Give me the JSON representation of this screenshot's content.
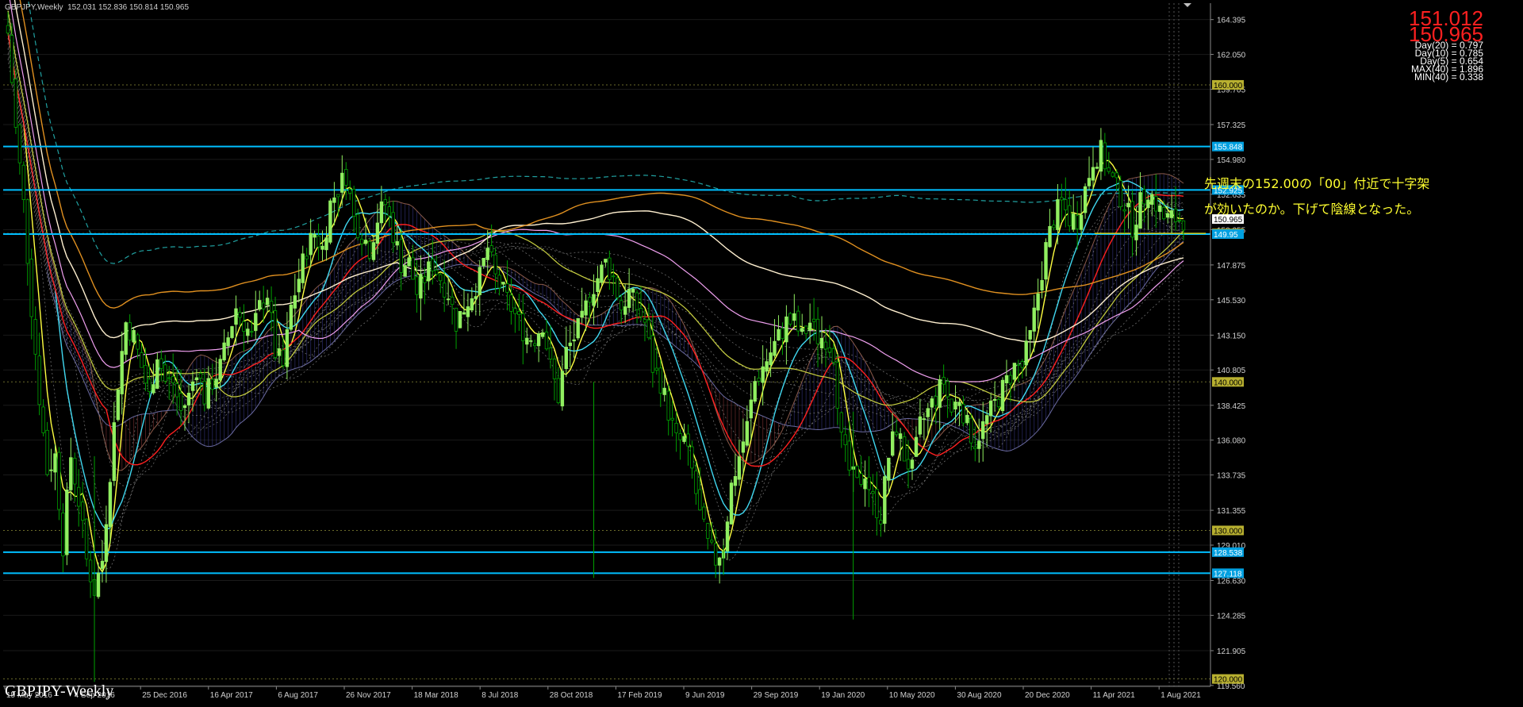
{
  "header": {
    "symbol_text": "GBPJPY,Weekly",
    "ohlc_text": "152.031 152.836 150.814 150.965"
  },
  "price_panel": {
    "bid": "151.012",
    "ask": "150.965",
    "stats": [
      "Day(20) = 0.797",
      "Day(10) = 0.785",
      "Day(5) = 0.654",
      "MAX(40) = 1.896",
      "MIN(40) = 0.338"
    ]
  },
  "caption": "GBPJPY-Weekly",
  "annotation": {
    "line1": "先週末の152.00の「00」付近で十字架",
    "line2": "が効いたのか。下げて陰線となった。"
  },
  "colors": {
    "background": "#000000",
    "bull_candle": "#90ee60",
    "bear_candle": "#00a000",
    "hline": "#00bfff",
    "bid": "#ff2020",
    "ask": "#ff2020",
    "annotation": "#ffff30"
  },
  "chart_data": {
    "type": "candlestick",
    "y_axis": {
      "range": [
        119.5,
        165.5
      ],
      "ticks": [
        "164.395",
        "162.050",
        "159.705",
        "157.325",
        "154.980",
        "152.635",
        "150.255",
        "147.875",
        "145.530",
        "143.150",
        "140.805",
        "138.425",
        "136.080",
        "133.735",
        "131.355",
        "129.010",
        "126.630",
        "124.285",
        "121.905",
        "119.560"
      ]
    },
    "x_axis": {
      "labels": [
        "15 May 2016",
        "4 Sep 2016",
        "25 Dec 2016",
        "16 Apr 2017",
        "6 Aug 2017",
        "26 Nov 2017",
        "18 Mar 2018",
        "8 Jul 2018",
        "28 Oct 2018",
        "17 Feb 2019",
        "9 Jun 2019",
        "29 Sep 2019",
        "19 Jan 2020",
        "10 May 2020",
        "30 Aug 2020",
        "20 Dec 2020",
        "11 Apr 2021",
        "1 Aug 2021"
      ]
    },
    "horizontal_lines": [
      {
        "value": 155.848,
        "label": "155.848"
      },
      {
        "value": 152.925,
        "label": "152.925"
      },
      {
        "value": 149.95,
        "label": "149.95"
      },
      {
        "value": 128.538,
        "label": "128.538"
      },
      {
        "value": 127.118,
        "label": "127.118"
      }
    ],
    "round_levels": [
      {
        "value": 160.0,
        "label": "160.000"
      },
      {
        "value": 150.0,
        "label": "150.000"
      },
      {
        "value": 140.0,
        "label": "140.000"
      },
      {
        "value": 130.0,
        "label": "130.000"
      },
      {
        "value": 120.0,
        "label": "120.000"
      }
    ],
    "current_price": {
      "value": 150.965,
      "label": "150.965"
    },
    "path_points": [
      [
        0,
        163.5
      ],
      [
        2,
        157
      ],
      [
        4,
        152
      ],
      [
        6,
        145
      ],
      [
        8,
        139
      ],
      [
        10,
        134
      ],
      [
        12,
        135
      ],
      [
        14,
        129
      ],
      [
        16,
        135
      ],
      [
        18,
        132
      ],
      [
        20,
        128
      ],
      [
        22,
        126
      ],
      [
        24,
        128
      ],
      [
        26,
        134
      ],
      [
        28,
        140
      ],
      [
        30,
        144
      ],
      [
        32,
        143
      ],
      [
        34,
        141
      ],
      [
        36,
        139
      ],
      [
        38,
        142
      ],
      [
        40,
        140
      ],
      [
        42,
        140
      ],
      [
        44,
        138
      ],
      [
        46,
        139
      ],
      [
        48,
        141
      ],
      [
        50,
        139
      ],
      [
        52,
        140
      ],
      [
        54,
        141
      ],
      [
        56,
        143
      ],
      [
        58,
        145
      ],
      [
        60,
        144
      ],
      [
        62,
        143
      ],
      [
        64,
        145
      ],
      [
        66,
        146
      ],
      [
        68,
        142
      ],
      [
        70,
        141
      ],
      [
        72,
        145
      ],
      [
        74,
        147
      ],
      [
        76,
        149
      ],
      [
        78,
        150
      ],
      [
        80,
        149
      ],
      [
        82,
        152
      ],
      [
        84,
        153
      ],
      [
        86,
        154
      ],
      [
        88,
        151
      ],
      [
        90,
        150
      ],
      [
        92,
        149
      ],
      [
        94,
        151
      ],
      [
        96,
        152
      ],
      [
        98,
        150
      ],
      [
        100,
        148
      ],
      [
        102,
        148
      ],
      [
        104,
        146
      ],
      [
        106,
        147
      ],
      [
        108,
        148
      ],
      [
        110,
        147
      ],
      [
        112,
        146
      ],
      [
        114,
        144
      ],
      [
        116,
        145
      ],
      [
        118,
        146
      ],
      [
        120,
        147
      ],
      [
        122,
        149
      ],
      [
        124,
        147
      ],
      [
        126,
        146
      ],
      [
        128,
        145
      ],
      [
        130,
        144
      ],
      [
        132,
        143
      ],
      [
        134,
        143
      ],
      [
        136,
        144
      ],
      [
        138,
        141
      ],
      [
        140,
        139
      ],
      [
        142,
        142
      ],
      [
        144,
        143
      ],
      [
        146,
        144
      ],
      [
        148,
        146
      ],
      [
        150,
        147
      ],
      [
        152,
        148
      ],
      [
        154,
        147
      ],
      [
        156,
        145
      ],
      [
        158,
        146
      ],
      [
        160,
        145
      ],
      [
        162,
        144
      ],
      [
        164,
        141
      ],
      [
        166,
        140
      ],
      [
        168,
        138
      ],
      [
        170,
        136
      ],
      [
        172,
        136
      ],
      [
        174,
        134
      ],
      [
        176,
        131
      ],
      [
        178,
        129
      ],
      [
        180,
        128
      ],
      [
        182,
        129
      ],
      [
        184,
        133
      ],
      [
        186,
        135
      ],
      [
        188,
        137
      ],
      [
        190,
        140
      ],
      [
        192,
        141
      ],
      [
        194,
        142
      ],
      [
        196,
        143
      ],
      [
        198,
        144
      ],
      [
        200,
        144
      ],
      [
        202,
        143
      ],
      [
        204,
        144
      ],
      [
        206,
        143
      ],
      [
        208,
        143
      ],
      [
        210,
        142
      ],
      [
        212,
        136
      ],
      [
        214,
        134
      ],
      [
        216,
        133
      ],
      [
        218,
        134
      ],
      [
        220,
        132
      ],
      [
        222,
        131
      ],
      [
        224,
        135
      ],
      [
        226,
        137
      ],
      [
        228,
        135
      ],
      [
        230,
        134
      ],
      [
        232,
        137
      ],
      [
        234,
        138
      ],
      [
        236,
        139
      ],
      [
        238,
        140
      ],
      [
        240,
        138
      ],
      [
        242,
        139
      ],
      [
        244,
        137
      ],
      [
        246,
        136
      ],
      [
        248,
        137
      ],
      [
        250,
        138
      ],
      [
        252,
        139
      ],
      [
        254,
        140
      ],
      [
        256,
        141
      ],
      [
        258,
        141
      ],
      [
        260,
        143
      ],
      [
        262,
        146
      ],
      [
        264,
        149
      ],
      [
        266,
        151
      ],
      [
        268,
        152
      ],
      [
        270,
        151
      ],
      [
        272,
        151
      ],
      [
        274,
        153
      ],
      [
        276,
        155
      ],
      [
        278,
        155.5
      ],
      [
        280,
        154
      ],
      [
        282,
        153
      ],
      [
        284,
        152
      ],
      [
        286,
        150.5
      ],
      [
        288,
        152
      ],
      [
        290,
        153
      ],
      [
        292,
        152
      ],
      [
        294,
        151
      ]
    ]
  }
}
